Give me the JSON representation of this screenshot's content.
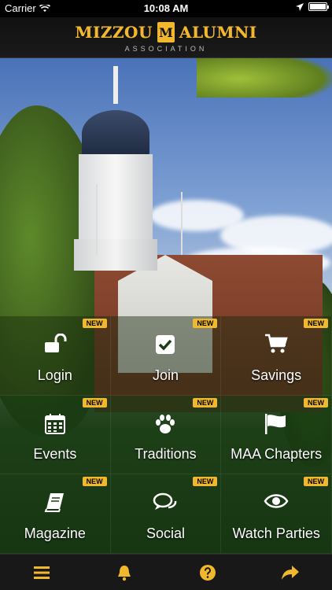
{
  "status_bar": {
    "carrier": "Carrier",
    "time": "10:08 AM"
  },
  "header": {
    "logo_left": "MIZZOU",
    "logo_badge": "M",
    "logo_right": "ALUMNI",
    "logo_sub": "ASSOCIATION"
  },
  "colors": {
    "accent": "#f1b82d",
    "tile_bg": "#1e3c14",
    "tabbar_bg": "#181818"
  },
  "tiles": [
    {
      "label": "Login",
      "icon": "unlock-icon",
      "badge": "NEW"
    },
    {
      "label": "Join",
      "icon": "checkbox-icon",
      "badge": "NEW"
    },
    {
      "label": "Savings",
      "icon": "cart-icon",
      "badge": "NEW"
    },
    {
      "label": "Events",
      "icon": "calendar-icon",
      "badge": "NEW"
    },
    {
      "label": "Traditions",
      "icon": "paw-icon",
      "badge": "NEW"
    },
    {
      "label": "MAA Chapters",
      "icon": "flag-icon",
      "badge": "NEW"
    },
    {
      "label": "Magazine",
      "icon": "book-icon",
      "badge": "NEW"
    },
    {
      "label": "Social",
      "icon": "chat-icon",
      "badge": "NEW"
    },
    {
      "label": "Watch Parties",
      "icon": "eye-icon",
      "badge": "NEW"
    }
  ],
  "tabbar": [
    {
      "icon": "menu-icon"
    },
    {
      "icon": "bell-icon"
    },
    {
      "icon": "help-icon"
    },
    {
      "icon": "share-icon"
    }
  ]
}
